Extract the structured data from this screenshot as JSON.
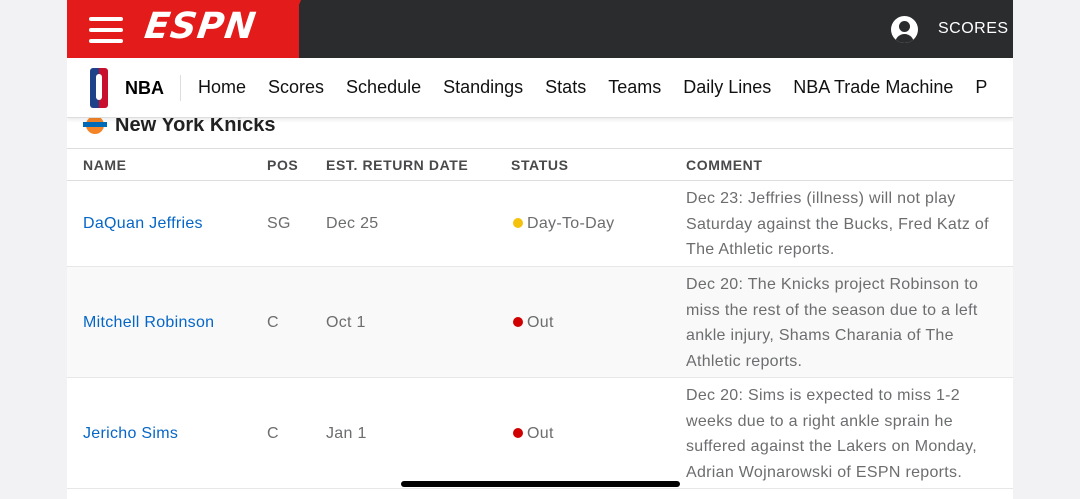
{
  "header": {
    "logo_text": "ESPN",
    "scores_label": "SCORES",
    "icons": {
      "menu": "hamburger-menu-icon",
      "account": "user-account-icon"
    }
  },
  "subnav": {
    "league": "NBA",
    "items": [
      "Home",
      "Scores",
      "Schedule",
      "Standings",
      "Stats",
      "Teams",
      "Daily Lines",
      "NBA Trade Machine",
      "P"
    ]
  },
  "team": {
    "name": "New York Knicks"
  },
  "table": {
    "columns": [
      "NAME",
      "POS",
      "EST. RETURN DATE",
      "STATUS",
      "COMMENT"
    ],
    "rows": [
      {
        "name": "DaQuan Jeffries",
        "pos": "SG",
        "return_date": "Dec 25",
        "status": "Day-To-Day",
        "status_color": "#f4c20d",
        "comment": [
          "Dec 23: Jeffries (illness) will not play",
          "Saturday against the Bucks, Fred Katz of",
          "The Athletic reports."
        ]
      },
      {
        "name": "Mitchell Robinson",
        "pos": "C",
        "return_date": "Oct 1",
        "status": "Out",
        "status_color": "#d00000",
        "comment": [
          "Dec 20: The Knicks project Robinson to",
          "miss the rest of the season due to a left",
          "ankle injury, Shams Charania of The",
          "Athletic reports."
        ]
      },
      {
        "name": "Jericho Sims",
        "pos": "C",
        "return_date": "Jan 1",
        "status": "Out",
        "status_color": "#d00000",
        "comment": [
          "Dec 20: Sims is expected to miss 1-2",
          "weeks due to a right ankle sprain he",
          "suffered against the Lakers on Monday,",
          "Adrian Wojnarowski of ESPN reports."
        ]
      }
    ]
  },
  "colors": {
    "espn_red": "#e41b1b",
    "header_dark": "#2b2c2d",
    "link_blue": "#0566c7"
  }
}
